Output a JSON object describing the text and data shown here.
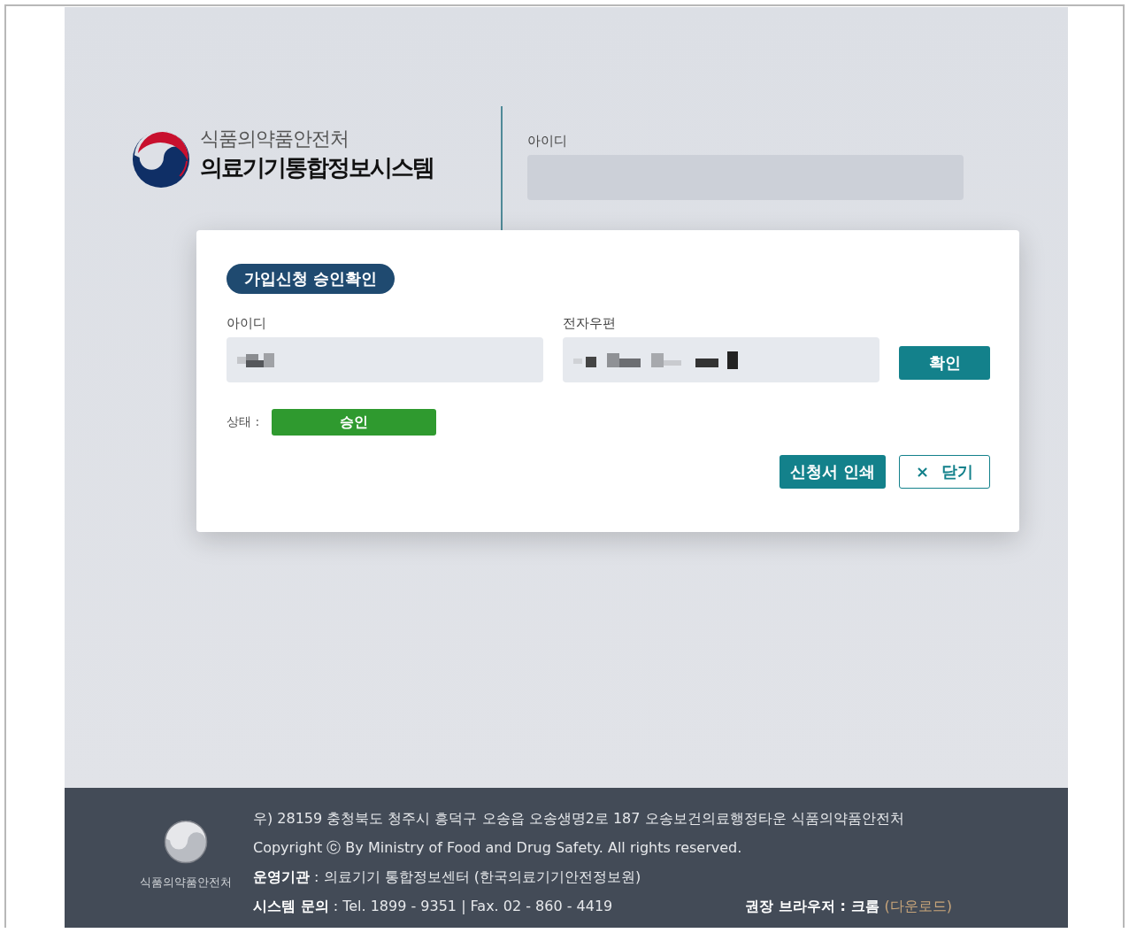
{
  "logo": {
    "org": "식품의약품안전처",
    "system": "의료기기통합정보시스템"
  },
  "login": {
    "id_label": "아이디"
  },
  "modal": {
    "title": "가입신청 승인확인",
    "fields": [
      {
        "label": "아이디",
        "kind": "redacted"
      },
      {
        "label": "전자우편",
        "kind": "redacted"
      }
    ],
    "confirm_button": "확인",
    "status": {
      "label": "상태 :",
      "value": "승인",
      "kind": "approved"
    },
    "buttons": [
      {
        "label": "신청서 인쇄",
        "kind": "primary"
      },
      {
        "label": "닫기",
        "icon": "×",
        "kind": "outline"
      }
    ]
  },
  "footer": {
    "org": "식품의약품안전처",
    "lines": [
      "우) 28159  충청북도 청주시 흥덕구 오송읍 오송생명2로 187 오송보건의료행정타운 식품의약품안전처",
      "Copyright ⓒ  By Ministry of Food and Drug Safety.  All rights reserved.",
      "**운영기관** : 의료기기 통합정보센터 (한국의료기기안전정보원)",
      "**시스템 문의** : Tel. 1899 - 9351  |  Fax. 02 - 860 - 4419"
    ],
    "browser": "권장 브라우저 : 크롬",
    "download_link": "(다운로드)"
  }
}
